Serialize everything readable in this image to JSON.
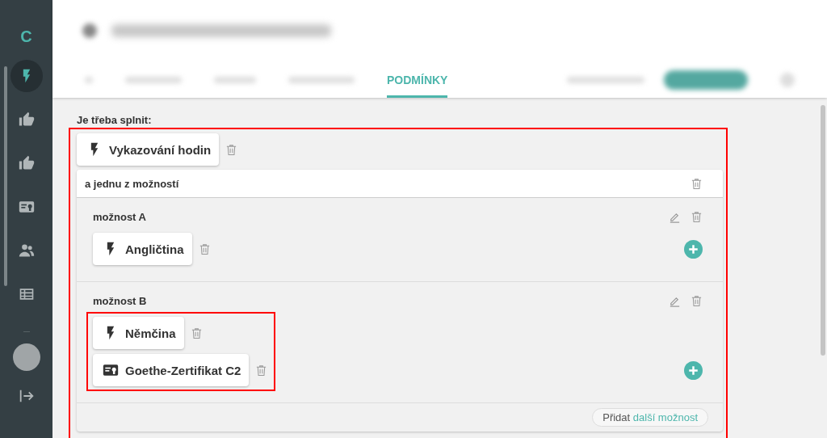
{
  "sidebar": {
    "logo": "C",
    "items": [
      {
        "kind": "bolt",
        "selected": true
      },
      {
        "kind": "thumb",
        "selected": false
      },
      {
        "kind": "thumb",
        "selected": false
      },
      {
        "kind": "certificate",
        "selected": false
      },
      {
        "kind": "people",
        "selected": false
      },
      {
        "kind": "table",
        "selected": false
      }
    ]
  },
  "tabs": [
    {
      "label": "PODMÍNKY",
      "selected": true
    }
  ],
  "requirements": {
    "heading": "Je třeba splnit:",
    "items": [
      {
        "kind": "skill",
        "label": "Vykazování hodin"
      }
    ],
    "group": {
      "title": "a jednu z možností",
      "options": [
        {
          "title": "možnost A",
          "items": [
            {
              "kind": "skill",
              "label": "Angličtina"
            }
          ]
        },
        {
          "title": "možnost B",
          "items": [
            {
              "kind": "skill",
              "label": "Němčina"
            },
            {
              "kind": "certificate",
              "label": "Goethe-Zertifikat C2"
            }
          ]
        }
      ],
      "add_option": {
        "prefix": "Přidat",
        "link": "další možnost"
      }
    }
  }
}
